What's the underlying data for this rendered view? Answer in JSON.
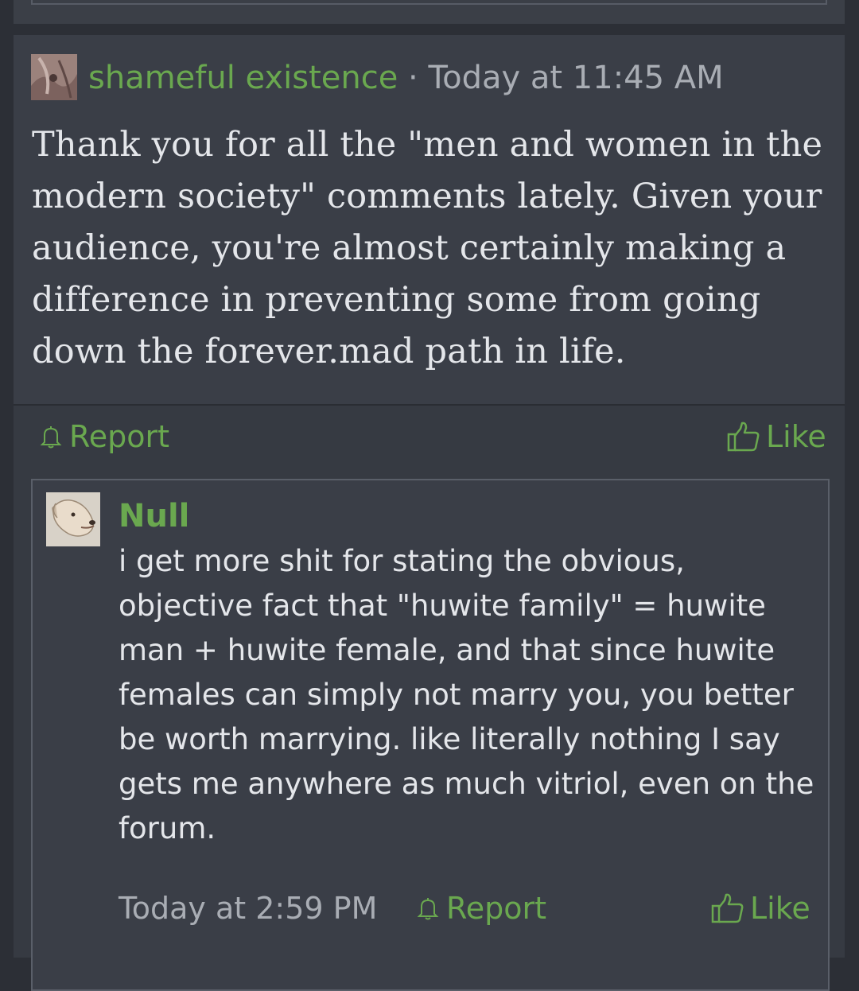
{
  "post": {
    "author": "shameful existence",
    "separator": " · ",
    "timestamp": "Today at 11:45 AM",
    "body": "Thank you for all the \"men and women in the modern society\" comments lately. Given your audience, you're almost certainly making a difference in preventing some from going down the forever.mad path in life.",
    "report_label": "Report",
    "like_label": "Like"
  },
  "quote": {
    "author": "Null",
    "body": "i get more shit for stating the obvious, objective fact that \"huwite family\" = huwite man + huwite female, and that since huwite females can simply not marry you, you better be worth marrying. like literally nothing I say gets me anywhere as much vitriol, even on the forum.",
    "timestamp": "Today at 2:59 PM",
    "report_label": "Report",
    "like_label": "Like"
  },
  "colors": {
    "accent": "#6aa84f",
    "background": "#2c2f36",
    "card": "#3a3e47",
    "text": "#e4e6ea",
    "muted": "#a9adb4"
  },
  "icons": [
    "bell-icon",
    "thumbs-up-icon"
  ]
}
